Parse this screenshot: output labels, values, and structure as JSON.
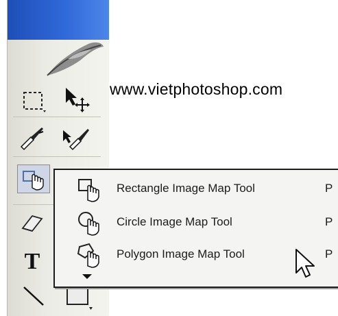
{
  "watermark": "www.vietphotoshop.com",
  "toolbox": {
    "tools": [
      {
        "name": "rectangular-marquee-tool"
      },
      {
        "name": "path-selection-tool"
      },
      {
        "name": "slice-tool"
      },
      {
        "name": "slice-select-tool"
      },
      {
        "name": "image-map-tool"
      },
      {
        "name": "eraser-tool"
      },
      {
        "name": "type-tool",
        "glyph": "T"
      },
      {
        "name": "line-tool"
      },
      {
        "name": "rectangle-tool"
      }
    ]
  },
  "flyout": {
    "items": [
      {
        "label": "Rectangle Image Map Tool",
        "shortcut": "P",
        "icon": "rectangle-image-map-icon"
      },
      {
        "label": "Circle Image Map Tool",
        "shortcut": "P",
        "icon": "circle-image-map-icon"
      },
      {
        "label": "Polygon Image Map Tool",
        "shortcut": "P",
        "icon": "polygon-image-map-icon"
      }
    ]
  },
  "colors": {
    "titlebar": "#2f68d8",
    "menu_bg": "#f4f4f2",
    "menu_border": "#1a1a1a"
  }
}
